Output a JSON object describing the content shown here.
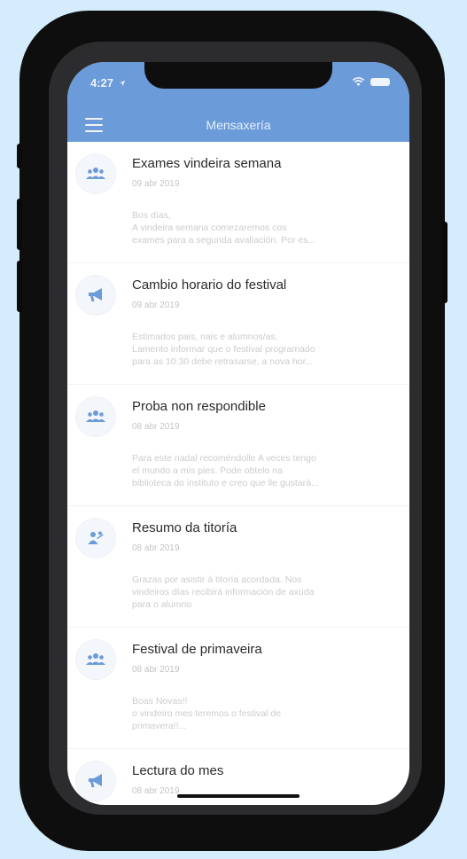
{
  "status_bar": {
    "time": "4:27"
  },
  "header": {
    "title": "Mensaxería"
  },
  "messages": [
    {
      "icon": "group-icon",
      "subject": "Exames vindeira semana",
      "date": "09 abr 2019",
      "preview": "Bos días,\nA vindeira semana comezaremos cos\nexames para a segunda avaliación. Por es..."
    },
    {
      "icon": "megaphone-icon",
      "subject": "Cambio horario do festival",
      "date": "09 abr 2019",
      "preview": "Estimados pais, nais e alumnos/as,\nLamento informar que o festival programado\npara as 10:30 debe retrasarse, a nova hor..."
    },
    {
      "icon": "group-icon",
      "subject": "Proba non respondible",
      "date": "08 abr 2019",
      "preview": "Para este nadal recoméndolle A veces tengo\nel mundo a mis pies. Pode obtelo na\nbiblioteca do instituto e creo que lle gustará..."
    },
    {
      "icon": "tutoring-icon",
      "subject": "Resumo da titoría",
      "date": "08 abr 2019",
      "preview": "Grazas por asistir á titoría acordada. Nos\nvindeiros días recibirá información de axuda\npara o alumno"
    },
    {
      "icon": "group-icon",
      "subject": "Festival de primaveira",
      "date": "08 abr 2019",
      "preview": "Boas Novas!!\no vindeiro mes teremos o festival de\nprimavera!!..."
    },
    {
      "icon": "megaphone-icon",
      "subject": "Lectura do mes",
      "date": "08 abr 2019",
      "preview": ""
    }
  ],
  "colors": {
    "header": "#6b9bd8",
    "icon": "#6b9bd8",
    "background": "#d4ecfb"
  }
}
